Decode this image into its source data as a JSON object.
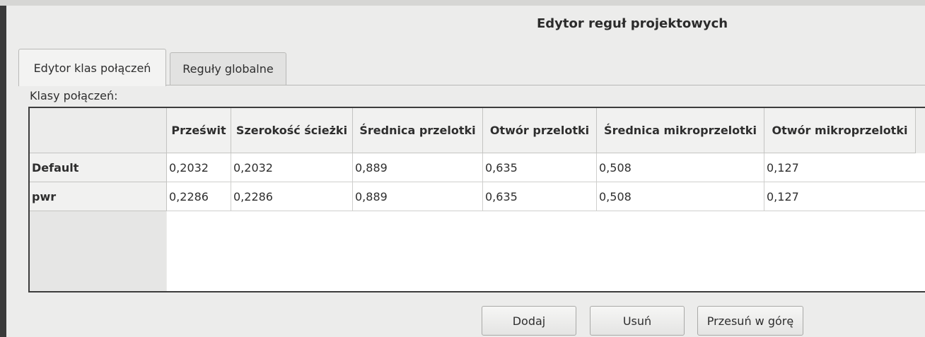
{
  "window": {
    "title": "Edytor reguł projektowych"
  },
  "tabs": [
    {
      "label": "Edytor klas połączeń",
      "active": true
    },
    {
      "label": "Reguły globalne",
      "active": false
    }
  ],
  "net_classes": {
    "section_label": "Klasy połączeń:",
    "columns": [
      "Prześwit",
      "Szerokość ścieżki",
      "Średnica przelotki",
      "Otwór przelotki",
      "Średnica mikroprzelotki",
      "Otwór mikroprzelotki"
    ],
    "rows": [
      {
        "name": "Default",
        "values": [
          "0,2032",
          "0,2032",
          "0,889",
          "0,635",
          "0,508",
          "0,127"
        ]
      },
      {
        "name": "pwr",
        "values": [
          "0,2286",
          "0,2286",
          "0,889",
          "0,635",
          "0,508",
          "0,127"
        ]
      }
    ]
  },
  "buttons": {
    "add": "Dodaj",
    "remove": "Usuń",
    "move_up": "Przesuń w górę"
  }
}
